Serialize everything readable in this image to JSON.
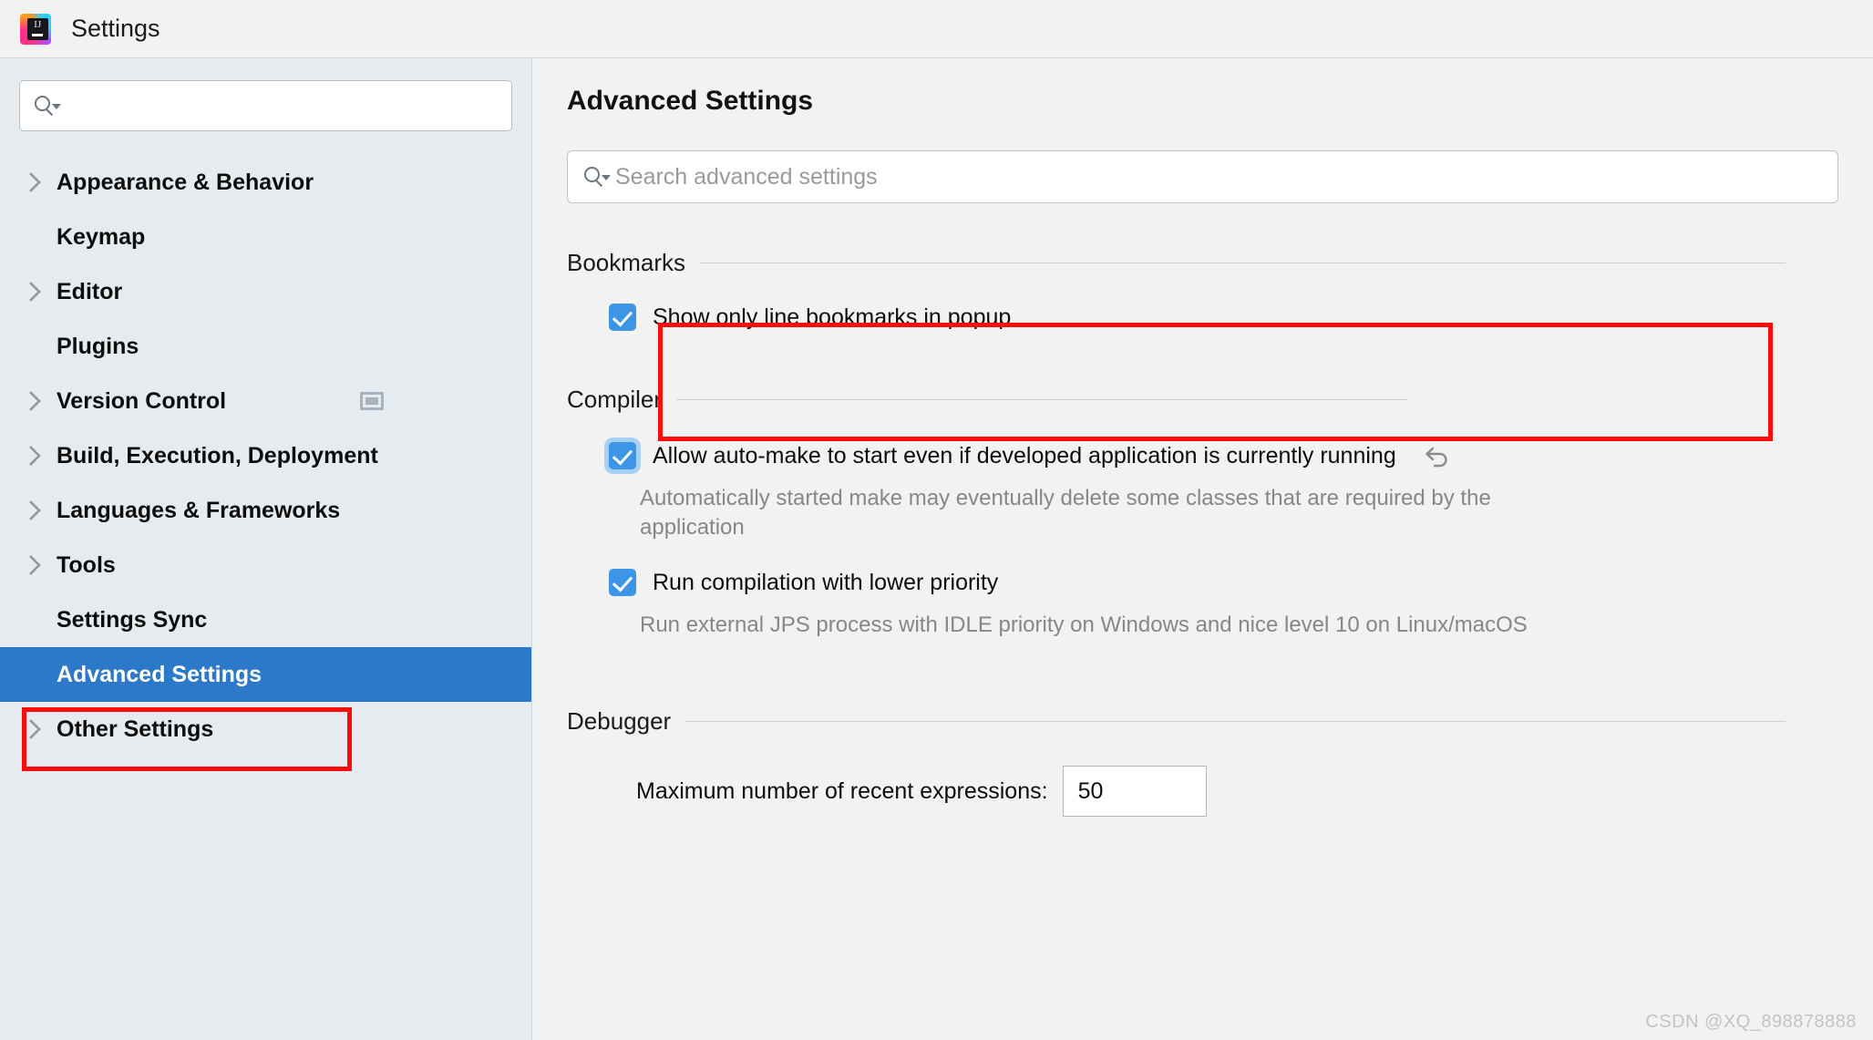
{
  "window": {
    "title": "Settings",
    "app_icon": "intellij-idea-logo"
  },
  "sidebar": {
    "search": {
      "value": "",
      "placeholder": "",
      "icon": "search-icon"
    },
    "items": [
      {
        "label": "Appearance & Behavior",
        "expandable": true,
        "selected": false
      },
      {
        "label": "Keymap",
        "expandable": false,
        "selected": false
      },
      {
        "label": "Editor",
        "expandable": true,
        "selected": false
      },
      {
        "label": "Plugins",
        "expandable": false,
        "selected": false
      },
      {
        "label": "Version Control",
        "expandable": true,
        "selected": false,
        "trailing_icon": "project-scope-icon"
      },
      {
        "label": "Build, Execution, Deployment",
        "expandable": true,
        "selected": false
      },
      {
        "label": "Languages & Frameworks",
        "expandable": true,
        "selected": false
      },
      {
        "label": "Tools",
        "expandable": true,
        "selected": false
      },
      {
        "label": "Settings Sync",
        "expandable": false,
        "selected": false
      },
      {
        "label": "Advanced Settings",
        "expandable": false,
        "selected": true
      },
      {
        "label": "Other Settings",
        "expandable": true,
        "selected": false
      }
    ]
  },
  "main": {
    "title": "Advanced Settings",
    "search": {
      "value": "",
      "placeholder": "Search advanced settings",
      "icon": "search-icon"
    },
    "sections": [
      {
        "title": "Bookmarks",
        "options": [
          {
            "label": "Show only line bookmarks in popup",
            "checked": true,
            "focused": false,
            "description": "",
            "revert": false
          }
        ]
      },
      {
        "title": "Compiler",
        "highlighted": true,
        "options": [
          {
            "label": "Allow auto-make to start even if developed application is currently running",
            "checked": true,
            "focused": true,
            "description": "Automatically started make may eventually delete some classes that are required by the application",
            "revert": true,
            "revert_icon": "revert-arrow-icon"
          },
          {
            "label": "Run compilation with lower priority",
            "checked": true,
            "focused": false,
            "description": "Run external JPS process with IDLE priority on Windows and nice level 10 on Linux/macOS",
            "revert": false
          }
        ]
      },
      {
        "title": "Debugger",
        "field": {
          "label": "Maximum number of recent expressions:",
          "value": "50"
        }
      }
    ]
  },
  "annotations": {
    "color": "#fc0d0d",
    "boxes": [
      "sidebar-advanced-settings",
      "compiler-section"
    ]
  },
  "watermark": "CSDN @XQ_898878888",
  "colors": {
    "selection_blue": "#2b79c8",
    "checkbox_blue": "#3d95e8",
    "sidebar_bg": "#e6ebef",
    "content_bg": "#f2f2f2",
    "annotation_red": "#fc0d0d"
  }
}
